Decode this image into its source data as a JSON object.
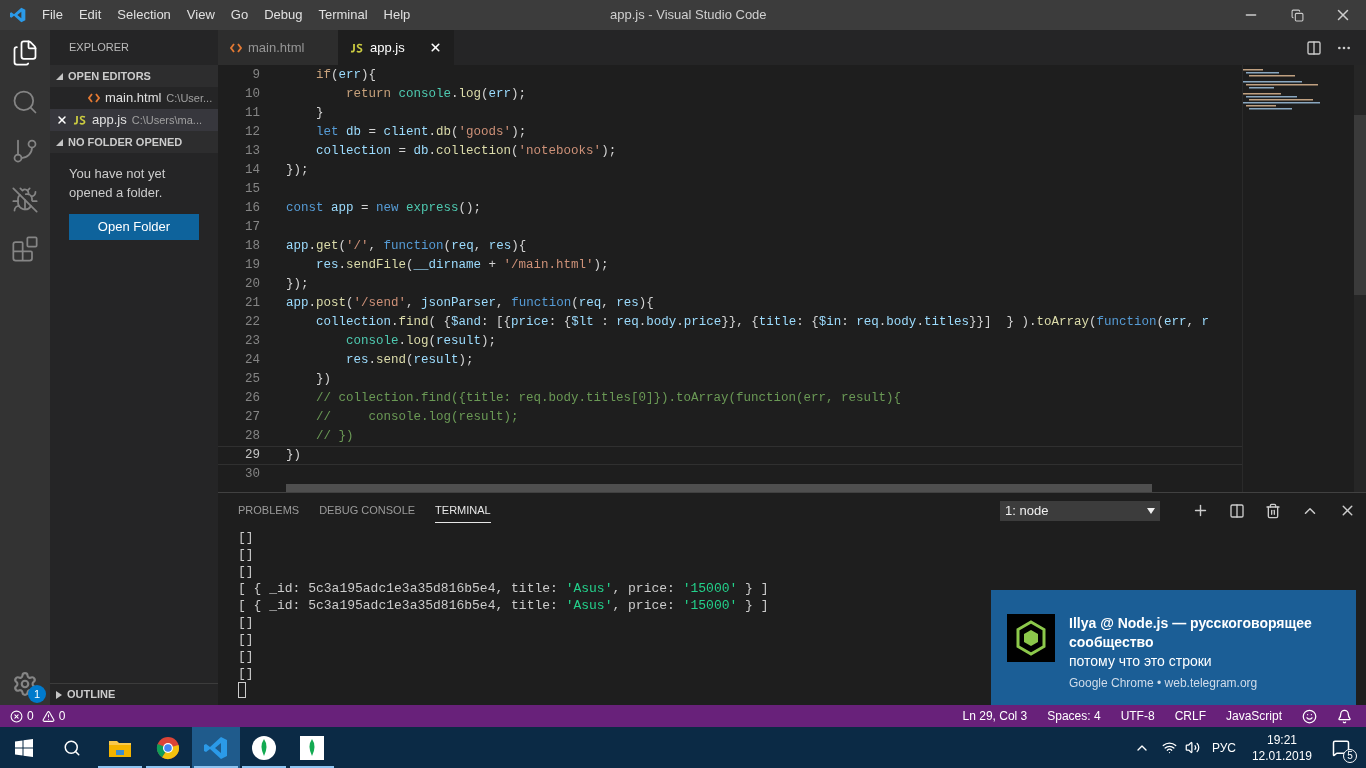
{
  "title_bar": {
    "menu": [
      "File",
      "Edit",
      "Selection",
      "View",
      "Go",
      "Debug",
      "Terminal",
      "Help"
    ],
    "title": "app.js - Visual Studio Code"
  },
  "activity_bar": {
    "items": [
      {
        "kind": "files",
        "selected": true
      },
      {
        "kind": "search",
        "selected": false
      },
      {
        "kind": "branch",
        "selected": false
      },
      {
        "kind": "debug",
        "selected": false
      },
      {
        "kind": "extensions",
        "selected": false
      }
    ],
    "settings_badge": "1"
  },
  "sidebar": {
    "title": "EXPLORER",
    "open_editors": {
      "title": "OPEN EDITORS",
      "expanded": true,
      "items": [
        {
          "name": "main.html",
          "path": "C:\\User...",
          "kind": "html",
          "selected": false
        },
        {
          "name": "app.js",
          "path": "C:\\Users\\ma...",
          "kind": "js",
          "selected": true
        }
      ]
    },
    "no_folder": {
      "title": "NO FOLDER OPENED",
      "expanded": true,
      "message": "You have not yet opened a folder.",
      "button": "Open Folder"
    },
    "outline": {
      "title": "OUTLINE",
      "expanded": false
    }
  },
  "editor": {
    "tabs": [
      {
        "name": "main.html",
        "kind": "html",
        "selected": false
      },
      {
        "name": "app.js",
        "kind": "js",
        "selected": true
      }
    ],
    "lines": [
      {
        "number": "9",
        "segments": [
          {
            "text": "    if",
            "kind": "keyword"
          },
          {
            "text": "(",
            "kind": "plain"
          },
          {
            "text": "err",
            "kind": "variable"
          },
          {
            "text": "){",
            "kind": "plain"
          }
        ]
      },
      {
        "number": "10",
        "segments": [
          {
            "text": "        return",
            "kind": "keyword"
          },
          {
            "text": " console",
            "kind": "type"
          },
          {
            "text": ".",
            "kind": "plain"
          },
          {
            "text": "log",
            "kind": "function"
          },
          {
            "text": "(",
            "kind": "plain"
          },
          {
            "text": "err",
            "kind": "variable"
          },
          {
            "text": ");",
            "kind": "plain"
          }
        ]
      },
      {
        "number": "11",
        "segments": [
          {
            "text": "    }",
            "kind": "plain"
          }
        ]
      },
      {
        "number": "12",
        "segments": [
          {
            "text": "    let",
            "kind": "storage"
          },
          {
            "text": " db",
            "kind": "variable"
          },
          {
            "text": " = ",
            "kind": "plain"
          },
          {
            "text": "client",
            "kind": "variable"
          },
          {
            "text": ".",
            "kind": "plain"
          },
          {
            "text": "db",
            "kind": "function"
          },
          {
            "text": "(",
            "kind": "plain"
          },
          {
            "text": "'goods'",
            "kind": "string"
          },
          {
            "text": ");",
            "kind": "plain"
          }
        ]
      },
      {
        "number": "13",
        "segments": [
          {
            "text": "    collection",
            "kind": "variable"
          },
          {
            "text": " = ",
            "kind": "plain"
          },
          {
            "text": "db",
            "kind": "variable"
          },
          {
            "text": ".",
            "kind": "plain"
          },
          {
            "text": "collection",
            "kind": "function"
          },
          {
            "text": "(",
            "kind": "plain"
          },
          {
            "text": "'notebooks'",
            "kind": "string"
          },
          {
            "text": ");",
            "kind": "plain"
          }
        ]
      },
      {
        "number": "14",
        "segments": [
          {
            "text": "});",
            "kind": "plain"
          }
        ]
      },
      {
        "number": "15"
      },
      {
        "number": "16",
        "segments": [
          {
            "text": "const",
            "kind": "storage"
          },
          {
            "text": " app",
            "kind": "variable"
          },
          {
            "text": " = ",
            "kind": "plain"
          },
          {
            "text": "new",
            "kind": "storage"
          },
          {
            "text": " express",
            "kind": "type"
          },
          {
            "text": "();",
            "kind": "plain"
          }
        ]
      },
      {
        "number": "17"
      },
      {
        "number": "18",
        "segments": [
          {
            "text": "app",
            "kind": "variable"
          },
          {
            "text": ".",
            "kind": "plain"
          },
          {
            "text": "get",
            "kind": "function"
          },
          {
            "text": "(",
            "kind": "plain"
          },
          {
            "text": "'/'",
            "kind": "string"
          },
          {
            "text": ", ",
            "kind": "plain"
          },
          {
            "text": "function",
            "kind": "storage"
          },
          {
            "text": "(",
            "kind": "plain"
          },
          {
            "text": "req",
            "kind": "variable"
          },
          {
            "text": ", ",
            "kind": "plain"
          },
          {
            "text": "res",
            "kind": "variable"
          },
          {
            "text": "){",
            "kind": "plain"
          }
        ]
      },
      {
        "number": "19",
        "segments": [
          {
            "text": "    res",
            "kind": "variable"
          },
          {
            "text": ".",
            "kind": "plain"
          },
          {
            "text": "sendFile",
            "kind": "function"
          },
          {
            "text": "(",
            "kind": "plain"
          },
          {
            "text": "__dirname",
            "kind": "variable"
          },
          {
            "text": " + ",
            "kind": "plain"
          },
          {
            "text": "'/main.html'",
            "kind": "string"
          },
          {
            "text": ");",
            "kind": "plain"
          }
        ]
      },
      {
        "number": "20",
        "segments": [
          {
            "text": "});",
            "kind": "plain"
          }
        ]
      },
      {
        "number": "21",
        "segments": [
          {
            "text": "app",
            "kind": "variable"
          },
          {
            "text": ".",
            "kind": "plain"
          },
          {
            "text": "post",
            "kind": "function"
          },
          {
            "text": "(",
            "kind": "plain"
          },
          {
            "text": "'/send'",
            "kind": "string"
          },
          {
            "text": ", ",
            "kind": "plain"
          },
          {
            "text": "jsonParser",
            "kind": "variable"
          },
          {
            "text": ", ",
            "kind": "plain"
          },
          {
            "text": "function",
            "kind": "storage"
          },
          {
            "text": "(",
            "kind": "plain"
          },
          {
            "text": "req",
            "kind": "variable"
          },
          {
            "text": ", ",
            "kind": "plain"
          },
          {
            "text": "res",
            "kind": "variable"
          },
          {
            "text": "){",
            "kind": "plain"
          }
        ]
      },
      {
        "number": "22",
        "segments": [
          {
            "text": "    collection",
            "kind": "variable"
          },
          {
            "text": ".",
            "kind": "plain"
          },
          {
            "text": "find",
            "kind": "function"
          },
          {
            "text": "( {",
            "kind": "plain"
          },
          {
            "text": "$and",
            "kind": "variable"
          },
          {
            "text": ": [{",
            "kind": "plain"
          },
          {
            "text": "price",
            "kind": "variable"
          },
          {
            "text": ": {",
            "kind": "plain"
          },
          {
            "text": "$lt",
            "kind": "variable"
          },
          {
            "text": " : ",
            "kind": "plain"
          },
          {
            "text": "req",
            "kind": "variable"
          },
          {
            "text": ".",
            "kind": "plain"
          },
          {
            "text": "body",
            "kind": "variable"
          },
          {
            "text": ".",
            "kind": "plain"
          },
          {
            "text": "price",
            "kind": "variable"
          },
          {
            "text": "}}, {",
            "kind": "plain"
          },
          {
            "text": "title",
            "kind": "variable"
          },
          {
            "text": ": {",
            "kind": "plain"
          },
          {
            "text": "$in",
            "kind": "variable"
          },
          {
            "text": ": ",
            "kind": "plain"
          },
          {
            "text": "req",
            "kind": "variable"
          },
          {
            "text": ".",
            "kind": "plain"
          },
          {
            "text": "body",
            "kind": "variable"
          },
          {
            "text": ".",
            "kind": "plain"
          },
          {
            "text": "titles",
            "kind": "variable"
          },
          {
            "text": "}}]  } ).",
            "kind": "plain"
          },
          {
            "text": "toArray",
            "kind": "function"
          },
          {
            "text": "(",
            "kind": "plain"
          },
          {
            "text": "function",
            "kind": "storage"
          },
          {
            "text": "(",
            "kind": "plain"
          },
          {
            "text": "err",
            "kind": "variable"
          },
          {
            "text": ", ",
            "kind": "plain"
          },
          {
            "text": "r",
            "kind": "variable"
          }
        ]
      },
      {
        "number": "23",
        "segments": [
          {
            "text": "        console",
            "kind": "type"
          },
          {
            "text": ".",
            "kind": "plain"
          },
          {
            "text": "log",
            "kind": "function"
          },
          {
            "text": "(",
            "kind": "plain"
          },
          {
            "text": "result",
            "kind": "variable"
          },
          {
            "text": ");",
            "kind": "plain"
          }
        ]
      },
      {
        "number": "24",
        "segments": [
          {
            "text": "        res",
            "kind": "variable"
          },
          {
            "text": ".",
            "kind": "plain"
          },
          {
            "text": "send",
            "kind": "function"
          },
          {
            "text": "(",
            "kind": "plain"
          },
          {
            "text": "result",
            "kind": "variable"
          },
          {
            "text": ");",
            "kind": "plain"
          }
        ]
      },
      {
        "number": "25",
        "segments": [
          {
            "text": "    })",
            "kind": "plain"
          }
        ]
      },
      {
        "number": "26",
        "segments": [
          {
            "text": "    // collection.find({title: req.body.titles[0]}).toArray(function(err, result){",
            "kind": "comment"
          }
        ]
      },
      {
        "number": "27",
        "segments": [
          {
            "text": "    //     console.log(result);",
            "kind": "comment"
          }
        ]
      },
      {
        "number": "28",
        "segments": [
          {
            "text": "    // })",
            "kind": "comment"
          }
        ]
      },
      {
        "number": "29",
        "current": true,
        "segments": [
          {
            "text": "})",
            "kind": "plain"
          }
        ]
      },
      {
        "number": "30"
      }
    ]
  },
  "panel": {
    "tabs": [
      {
        "label": "PROBLEMS",
        "selected": false
      },
      {
        "label": "DEBUG CONSOLE",
        "selected": false
      },
      {
        "label": "TERMINAL",
        "selected": true
      }
    ],
    "terminal_select": "1: node",
    "lines": [
      [
        {
          "text": "[]",
          "kind": "plain"
        }
      ],
      [
        {
          "text": "[]",
          "kind": "plain"
        }
      ],
      [
        {
          "text": "[]",
          "kind": "plain"
        }
      ],
      [
        {
          "text": "[ { _id: 5c3a195adc1e3a35d816b5e4, title: ",
          "kind": "plain"
        },
        {
          "text": "'Asus'",
          "kind": "string"
        },
        {
          "text": ", price: ",
          "kind": "plain"
        },
        {
          "text": "'15000'",
          "kind": "string"
        },
        {
          "text": " } ]",
          "kind": "plain"
        }
      ],
      [
        {
          "text": "[ { _id: 5c3a195adc1e3a35d816b5e4, title: ",
          "kind": "plain"
        },
        {
          "text": "'Asus'",
          "kind": "string"
        },
        {
          "text": ", price: ",
          "kind": "plain"
        },
        {
          "text": "'15000'",
          "kind": "string"
        },
        {
          "text": " } ]",
          "kind": "plain"
        }
      ],
      [
        {
          "text": "[]",
          "kind": "plain"
        }
      ],
      [
        {
          "text": "[]",
          "kind": "plain"
        }
      ],
      [
        {
          "text": "[]",
          "kind": "plain"
        }
      ],
      [
        {
          "text": "[]",
          "kind": "plain"
        }
      ]
    ]
  },
  "status_bar": {
    "errors": "0",
    "warnings": "0",
    "items": [
      "Ln 29, Col 3",
      "Spaces: 4",
      "UTF-8",
      "CRLF",
      "JavaScript"
    ]
  },
  "notification": {
    "title": "Illya @ Node.js — русскоговорящее сообщество",
    "body": "потому что это строки",
    "source": "Google Chrome • web.telegram.org"
  },
  "taskbar": {
    "apps": [
      {
        "kind": "folder",
        "active": false,
        "running": true
      },
      {
        "kind": "browser",
        "active": false,
        "running": true
      },
      {
        "kind": "editor",
        "active": true,
        "running": true
      },
      {
        "kind": "leaf-round",
        "active": false,
        "running": true
      },
      {
        "kind": "leaf-square",
        "active": false,
        "running": true
      }
    ],
    "tray": {
      "language": "РУС",
      "time": "19:21",
      "date": "12.01.2019",
      "notification_count": "5"
    }
  }
}
